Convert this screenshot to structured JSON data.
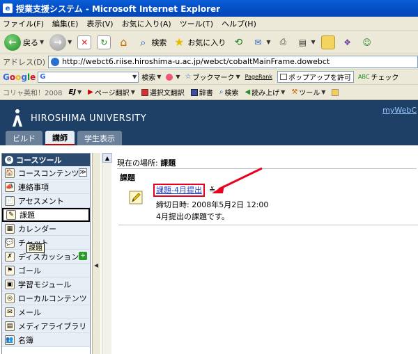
{
  "window": {
    "title": "授業支援システム - Microsoft Internet Explorer"
  },
  "menu": [
    "ファイル(F)",
    "編集(E)",
    "表示(V)",
    "お気に入り(A)",
    "ツール(T)",
    "ヘルプ(H)"
  ],
  "toolbar": {
    "back": "戻る",
    "search": "検索",
    "favorites": "お気に入り"
  },
  "address": {
    "label": "アドレス(D)",
    "url": "http://webct6.riise.hiroshima-u.ac.jp/webct/cobaltMainFrame.dowebct"
  },
  "google": {
    "logo": "Google",
    "search_label": "検索",
    "bookmark": "ブックマーク",
    "pagerank": "PageRank",
    "popup": "ポップアップを許可",
    "check": "チェック"
  },
  "dict": {
    "label": "コリャ英和！2008",
    "ej": "EJ",
    "page_translate": "ページ翻訳",
    "select_translate": "選択文翻訳",
    "dictionary": "辞書",
    "search": "検索",
    "read_aloud": "読み上げ",
    "tools": "ツール"
  },
  "banner": {
    "university": "HIROSHIMA UNIVERSITY",
    "mywebct": "myWebC"
  },
  "tabs": [
    "ビルド",
    "講師",
    "学生表示"
  ],
  "sidebar": {
    "header": "コースツール",
    "items": [
      {
        "label": "コースコンテンツ",
        "icon": "🏠"
      },
      {
        "label": "連絡事項",
        "icon": "📣"
      },
      {
        "label": "アセスメント",
        "icon": "📄"
      },
      {
        "label": "課題",
        "icon": "✎"
      },
      {
        "label": "カレンダー",
        "icon": "▦"
      },
      {
        "label": "チャット",
        "icon": "💬"
      },
      {
        "label": "ディスカッション",
        "icon": "✗"
      },
      {
        "label": "ゴール",
        "icon": "⚑"
      },
      {
        "label": "学習モジュール",
        "icon": "▣"
      },
      {
        "label": "ローカルコンテンツ",
        "icon": "◎"
      },
      {
        "label": "メール",
        "icon": "✉"
      },
      {
        "label": "メディアライブラリ",
        "icon": "▤"
      },
      {
        "label": "名簿",
        "icon": "👥"
      }
    ],
    "tooltip": "課題"
  },
  "content": {
    "location_label": "現在の場所:",
    "location_value": "課題",
    "section_title": "課題",
    "assignment_title": "課題-4月提出",
    "due": "締切日時: 2008年5月2日 12:00",
    "description": "4月提出の課題です。"
  },
  "colors": {
    "highlight": "#e8001c",
    "banner": "#1e3f66",
    "link": "#1a3fc4"
  }
}
